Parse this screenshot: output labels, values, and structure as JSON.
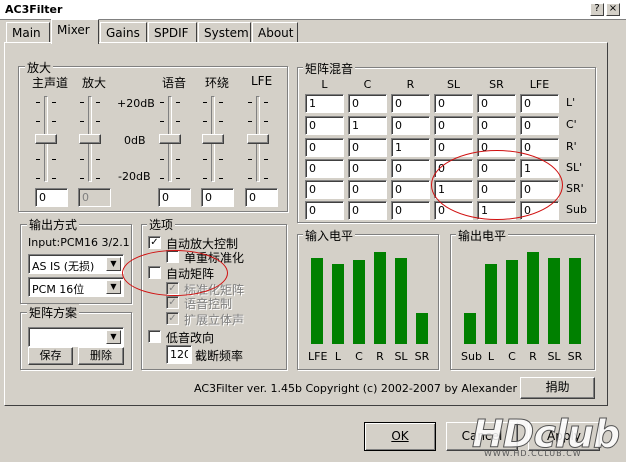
{
  "window": {
    "title": "AC3Filter",
    "help_button": "?",
    "close_button": "×"
  },
  "tabs": [
    "Main",
    "Mixer",
    "Gains",
    "SPDIF",
    "System",
    "About"
  ],
  "gain": {
    "title": "放大",
    "labels": [
      "主声道",
      "放大",
      "语音",
      "环绕",
      "LFE"
    ],
    "scale": [
      "+20dB",
      "0dB",
      "-20dB"
    ],
    "values": [
      "0",
      "0",
      "0",
      "0",
      "0"
    ]
  },
  "matrix": {
    "title": "矩阵混音",
    "columns": [
      "L",
      "C",
      "R",
      "SL",
      "SR",
      "LFE"
    ],
    "rows": [
      "L'",
      "C'",
      "R'",
      "SL'",
      "SR'",
      "Sub"
    ],
    "cells": [
      [
        "1",
        "0",
        "0",
        "0",
        "0",
        "0"
      ],
      [
        "0",
        "1",
        "0",
        "0",
        "0",
        "0"
      ],
      [
        "0",
        "0",
        "1",
        "0",
        "0",
        "0"
      ],
      [
        "0",
        "0",
        "0",
        "0",
        "0",
        "1"
      ],
      [
        "0",
        "0",
        "0",
        "1",
        "0",
        "0"
      ],
      [
        "0",
        "0",
        "0",
        "0",
        "1",
        "0"
      ]
    ]
  },
  "output": {
    "title": "输出方式",
    "input_label": "Input:PCM16 3/2.1",
    "mode": "AS IS (无损)",
    "format": "PCM 16位"
  },
  "options": {
    "title": "选项",
    "items": [
      {
        "label": "自动放大控制",
        "checked": true,
        "disabled": false
      },
      {
        "label": "单重标准化",
        "checked": false,
        "disabled": false
      },
      {
        "label": "自动矩阵",
        "checked": false,
        "disabled": false
      },
      {
        "label": "标准化矩阵",
        "checked": true,
        "disabled": true
      },
      {
        "label": "语音控制",
        "checked": true,
        "disabled": true
      },
      {
        "label": "扩展立体声",
        "checked": true,
        "disabled": true
      },
      {
        "label": "低音改向",
        "checked": false,
        "disabled": false
      }
    ],
    "crossover_value": "120",
    "crossover_label": "截断频率"
  },
  "preset": {
    "title": "矩阵方案",
    "value": "",
    "save": "保存",
    "delete": "删除"
  },
  "input_levels": {
    "title": "输入电平",
    "channels": [
      "LFE",
      "L",
      "C",
      "R",
      "SL",
      "SR"
    ],
    "levels": [
      0.86,
      0.8,
      0.84,
      0.92,
      0.86,
      0.31
    ]
  },
  "output_levels": {
    "title": "输出电平",
    "channels": [
      "Sub",
      "L",
      "C",
      "R",
      "SL",
      "SR"
    ],
    "levels": [
      0.31,
      0.8,
      0.84,
      0.92,
      0.86,
      0.86
    ]
  },
  "footer": {
    "copyright": "AC3Filter ver. 1.45b Copyright (c) 2002-2007 by Alexander Vigovsky",
    "help": "捐助",
    "ok": "OK",
    "cancel": "Cancel",
    "apply": "Apply"
  },
  "watermark": {
    "brand": "HDCLUB",
    "url": "WWW.HD.CCLUB.CW",
    "sub": "high definition club"
  },
  "colors": {
    "meter": "#008000",
    "annotation": "#d01010"
  }
}
